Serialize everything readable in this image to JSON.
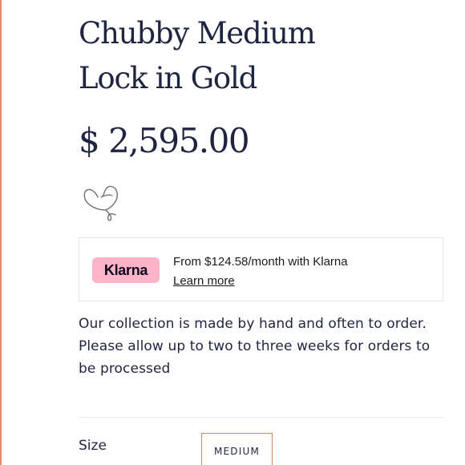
{
  "product": {
    "title_line1": "Chubby Medium",
    "title_line2": "Lock in Gold",
    "price": "$ 2,595.00"
  },
  "wishlist": {
    "icon": "heart-icon"
  },
  "klarna": {
    "badge": "Klarna",
    "installment_text": "From $124.58/month with Klarna",
    "learn_more": "Learn more",
    "badge_color": "#ffb3c7"
  },
  "info": {
    "line1": "Our collection is made by hand and often to order.",
    "line2": "Please allow up to two to three weeks for orders to be processed"
  },
  "size": {
    "label": "Size",
    "selected": "MEDIUM"
  },
  "colors": {
    "text": "#1f2440",
    "accent_border": "#d9826a"
  }
}
